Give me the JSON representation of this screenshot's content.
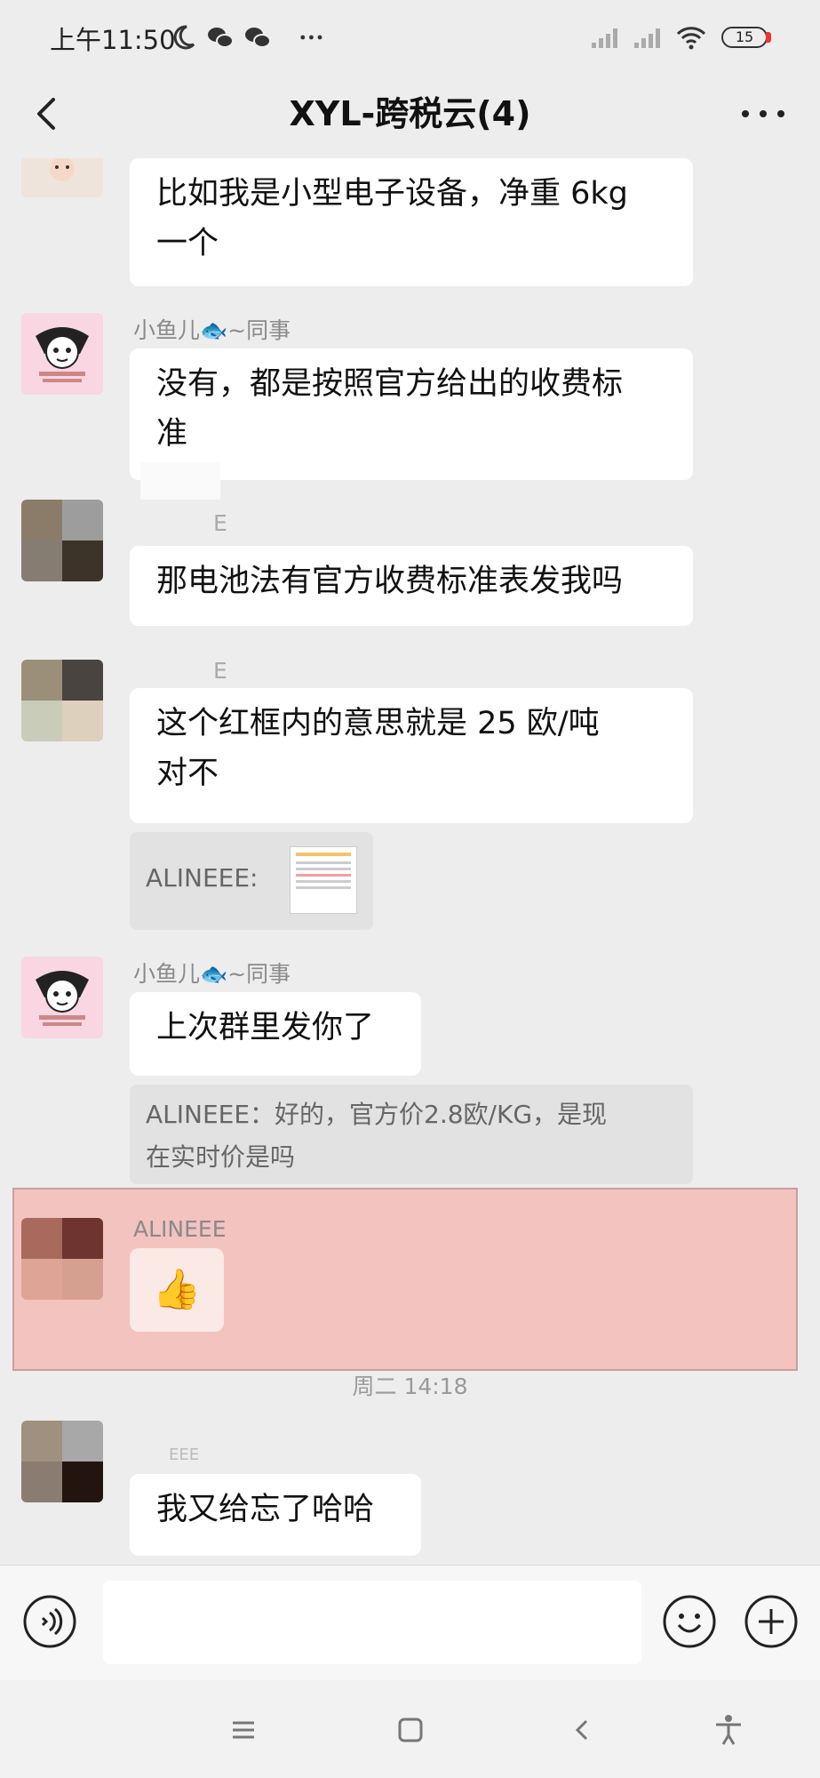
{
  "status_bar": {
    "time": "上午11:50",
    "battery": "15"
  },
  "header": {
    "title": "XYL-跨税云(4)"
  },
  "messages": {
    "m1": {
      "text_line1": "比如我是小型电子设备，净重 6kg",
      "text_line2": "一个"
    },
    "m2": {
      "sender": "小鱼儿🐟~同事",
      "text_line1": "没有，都是按照官方给出的收费标",
      "text_line2": "准"
    },
    "m3": {
      "sender": "E",
      "text": "那电池法有官方收费标准表发我吗"
    },
    "m4": {
      "sender": "E",
      "text_line1": "这个红框内的意思就是 25 欧/吨",
      "text_line2": "对不",
      "quote": "ALINEEE:"
    },
    "m5": {
      "sender": "小鱼儿🐟~同事",
      "text": "上次群里发你了",
      "quote_line1": "ALINEEE：好的，官方价2.8欧/KG，是现",
      "quote_line2": "在实时价是吗"
    },
    "m6": {
      "sender": "ALINEEE",
      "emoji": "👍"
    },
    "timestamp": "周二 14:18",
    "m7": {
      "sender": "EEE",
      "text": "我又给忘了哈哈"
    }
  },
  "colors": {
    "highlight": "#f2c3bf",
    "bubble": "#ffffff",
    "background": "#ededed"
  },
  "icons": [
    "moon-icon",
    "wechat-icon",
    "signal-icon",
    "wifi-icon",
    "battery-icon",
    "back-icon",
    "more-icon",
    "voice-icon",
    "emoji-icon",
    "plus-icon",
    "menu-icon",
    "home-icon",
    "nav-back-icon",
    "accessibility-icon"
  ]
}
